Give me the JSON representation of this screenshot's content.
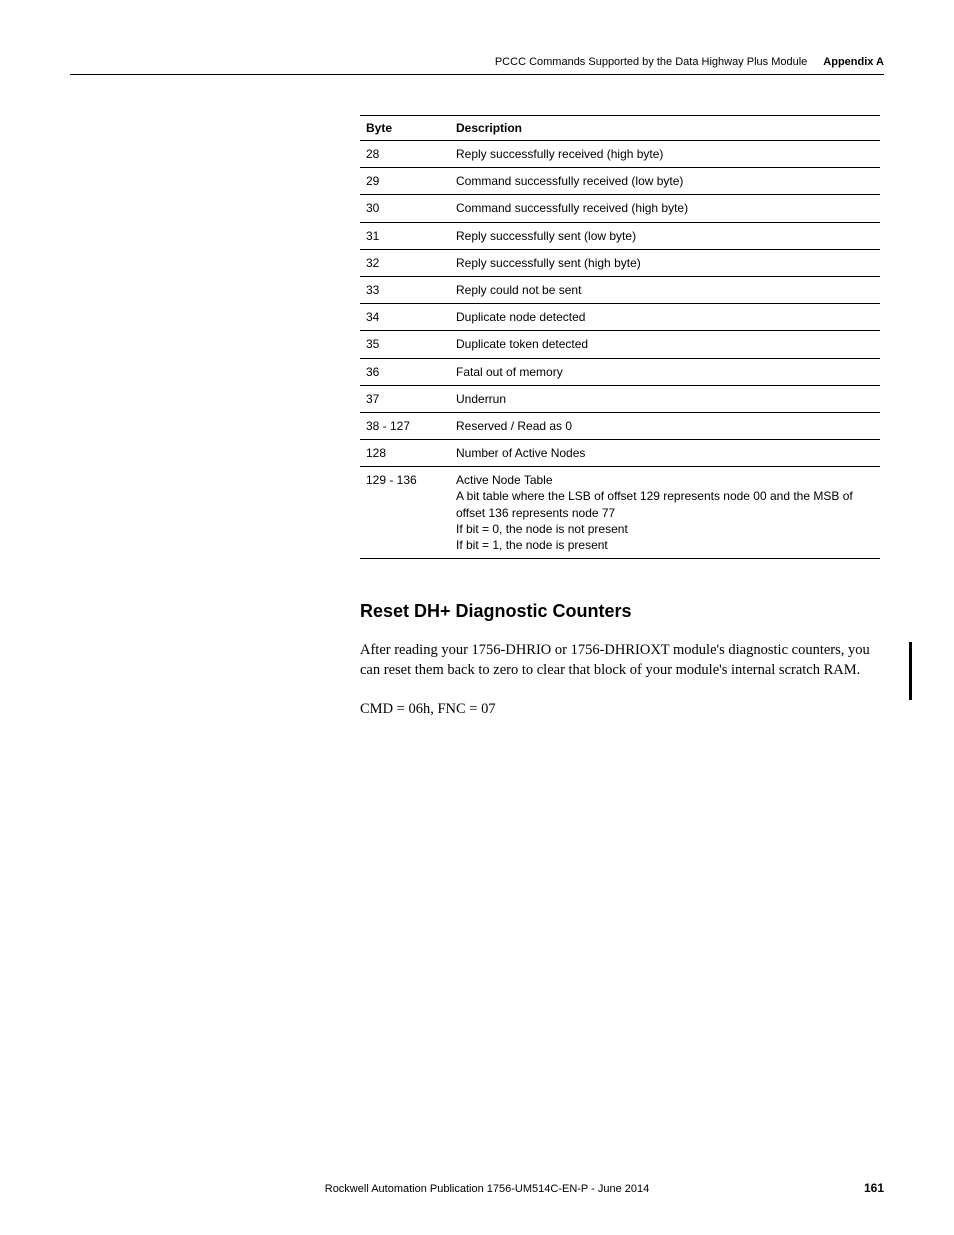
{
  "header": {
    "title": "PCCC Commands Supported by the Data Highway Plus Module",
    "appendix": "Appendix A"
  },
  "table": {
    "head": {
      "col1": "Byte",
      "col2": "Description"
    },
    "rows": [
      {
        "c1": "28",
        "c2": "Reply successfully received (high byte)"
      },
      {
        "c1": "29",
        "c2": "Command successfully received (low byte)"
      },
      {
        "c1": "30",
        "c2": "Command successfully received (high byte)"
      },
      {
        "c1": "31",
        "c2": "Reply successfully sent (low byte)"
      },
      {
        "c1": "32",
        "c2": "Reply successfully sent (high byte)"
      },
      {
        "c1": "33",
        "c2": "Reply could not be sent"
      },
      {
        "c1": "34",
        "c2": "Duplicate node detected"
      },
      {
        "c1": "35",
        "c2": "Duplicate token detected"
      },
      {
        "c1": "36",
        "c2": "Fatal out of memory"
      },
      {
        "c1": "37",
        "c2": "Underrun"
      },
      {
        "c1": "38 - 127",
        "c2": "Reserved / Read as 0"
      },
      {
        "c1": "128",
        "c2": "Number of Active Nodes"
      },
      {
        "c1": "129 - 136",
        "c2": "Active Node Table\nA bit table where the LSB of offset 129 represents node 00 and the MSB of offset 136 represents node 77\nIf bit = 0, the node is not present\nIf bit = 1, the node is present"
      }
    ]
  },
  "section": {
    "heading": "Reset DH+ Diagnostic Counters",
    "para1": "After reading your 1756-DHRIO or 1756-DHRIOXT module's diagnostic counters, you can reset them back to zero to clear that block of your module's internal scratch RAM.",
    "para2": "CMD = 06h, FNC = 07"
  },
  "footer": {
    "publication": "Rockwell Automation Publication 1756-UM514C-EN-P - June 2014",
    "page": "161"
  }
}
